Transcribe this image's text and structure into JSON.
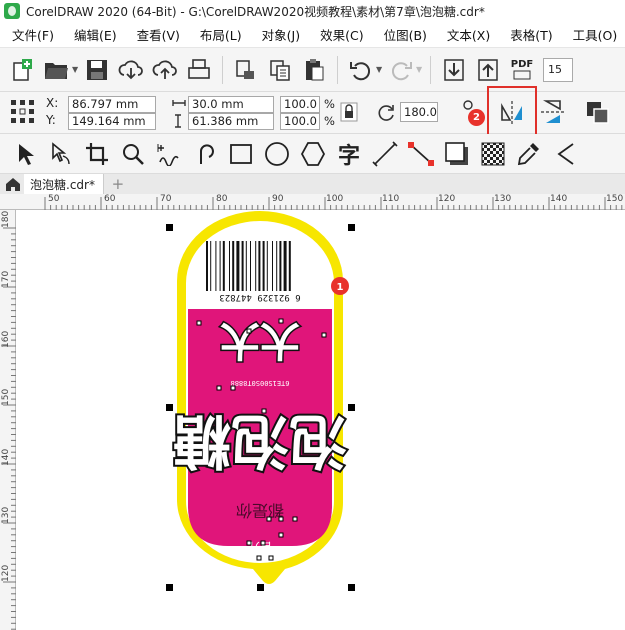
{
  "window": {
    "title": "CorelDRAW 2020 (64-Bit) - G:\\CorelDRAW2020视频教程\\素材\\第7章\\泡泡糖.cdr*"
  },
  "menu": {
    "items": [
      "文件(F)",
      "编辑(E)",
      "查看(V)",
      "布局(L)",
      "对象(J)",
      "效果(C)",
      "位图(B)",
      "文本(X)",
      "表格(T)",
      "工具(O)"
    ]
  },
  "toolbar": {
    "zoom_value": "15",
    "pdf_label": "PDF"
  },
  "propbar": {
    "x_label": "X:",
    "y_label": "Y:",
    "x_value": "86.797 mm",
    "y_value": "149.164 mm",
    "width_value": "30.0 mm",
    "height_value": "61.386 mm",
    "scale_x": "100.0",
    "scale_y": "100.0",
    "percent": "%",
    "rotation": "180.0"
  },
  "annotations": {
    "badge1": "1",
    "badge2": "2",
    "highlight_color": "#e0302a"
  },
  "document": {
    "tab_name": "泡泡糖.cdr*"
  },
  "ruler": {
    "top_ticks": [
      "50",
      "60",
      "70",
      "80",
      "90",
      "100",
      "110",
      "120",
      "130",
      "140",
      "150"
    ],
    "left_ticks": [
      "180",
      "170",
      "160",
      "150",
      "140",
      "130",
      "120"
    ]
  },
  "artwork": {
    "barcode_digits": "6 921329 447823",
    "title_top": "大大",
    "title_main": "泡泡糖",
    "line1": "都是你",
    "line2": "自开"
  },
  "colors": {
    "label_fill": "#e0157a",
    "outline": "#f7e600",
    "selection": "#000000"
  }
}
